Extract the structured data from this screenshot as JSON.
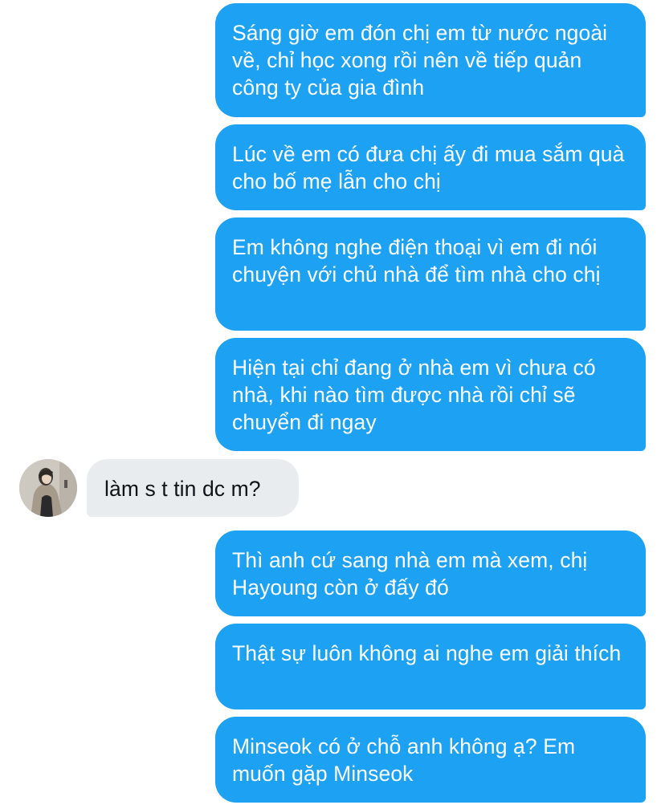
{
  "conversation": {
    "messages": [
      {
        "side": "sent",
        "text": "Sáng giờ em đón chị em từ nước ngoài về, chỉ học xong rồi nên về tiếp quản công ty của gia đình"
      },
      {
        "side": "sent",
        "text": "Lúc về em có đưa chị ấy đi mua sắm quà cho bố mẹ lẫn cho chị"
      },
      {
        "side": "sent",
        "text": "Em không nghe điện thoại vì em đi nói chuyện với chủ nhà để tìm nhà cho chị"
      },
      {
        "side": "sent",
        "text": "Hiện tại chỉ đang ở nhà em vì chưa có nhà, khi nào tìm được nhà rồi chỉ sẽ chuyển đi ngay"
      },
      {
        "side": "received",
        "text": "làm s t tin dc m?"
      },
      {
        "side": "sent",
        "text": "Thì anh cứ sang nhà em mà xem, chị Hayoung còn ở đấy đó"
      },
      {
        "side": "sent",
        "text": "Thật sự luôn không ai nghe em giải thích"
      },
      {
        "side": "sent",
        "text": "Minseok có ở chỗ anh không ạ? Em muốn gặp Minseok"
      }
    ]
  },
  "colors": {
    "sent_bubble": "#1da1f2",
    "received_bubble": "#e9ecef",
    "sent_text": "#ffffff",
    "received_text": "#0f1419"
  },
  "icons": {
    "contact_avatar": "user-avatar-photo"
  }
}
